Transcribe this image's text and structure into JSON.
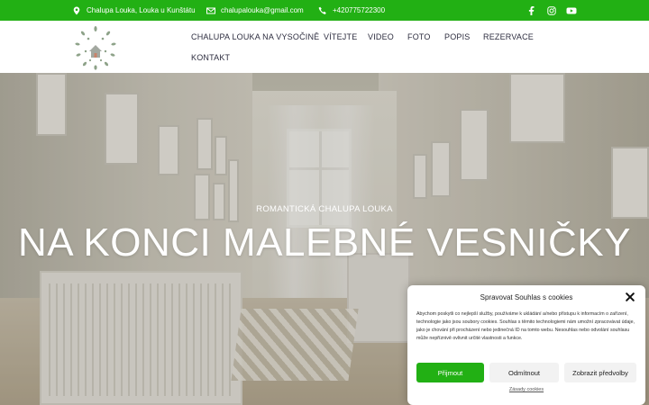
{
  "topbar": {
    "address": "Chalupa Louka, Louka u Kunštátu",
    "email": "chalupalouka@gmail.com",
    "phone": "+420775722300",
    "icons": [
      "map-pin-icon",
      "mail-icon",
      "phone-icon",
      "facebook-icon",
      "instagram-icon",
      "youtube-icon"
    ],
    "background": "#22b014"
  },
  "nav": {
    "items": [
      "CHALUPA LOUKA NA VYSOČINĚ",
      "VÍTEJTE",
      "VIDEO",
      "FOTO",
      "POPIS",
      "REZERVACE",
      "KONTAKT"
    ]
  },
  "hero": {
    "subtitle": "ROMANTICKÁ CHALUPA LOUKA",
    "title": "NA KONCI MALEBNÉ VESNIČKY"
  },
  "cookie": {
    "title": "Spravovat Souhlas s cookies",
    "text": "Abychom poskytli co nejlepší služby, používáme k ukládání a/nebo přístupu k informacím o zařízení, technologie jako jsou soubory cookies. Souhlas s těmito technologiemi nám umožní zpracovávat údaje, jako je chování při procházení nebo jedinečná ID na tomto webu. Nesouhlas nebo odvolání souhlasu může nepříznivě ovlivnit určité vlastnosti a funkce.",
    "accept_label": "Přijmout",
    "deny_label": "Odmítnout",
    "prefs_label": "Zobrazit předvolby",
    "link_label": "Zásady cookies",
    "accent": "#22b014"
  }
}
